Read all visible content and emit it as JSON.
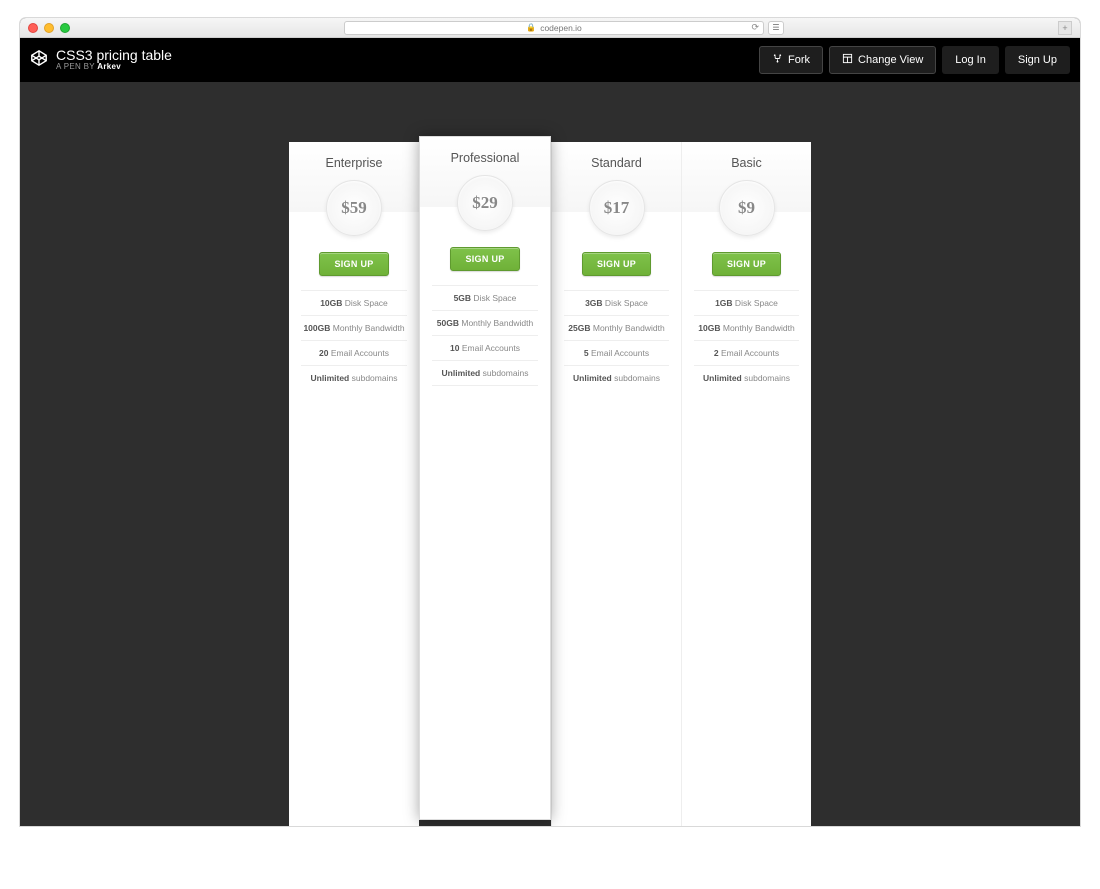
{
  "browser": {
    "url_host": "codepen.io"
  },
  "header": {
    "title": "CSS3 pricing table",
    "subtitle_prefix": "A PEN BY ",
    "author": "Arkev",
    "buttons": {
      "fork": "Fork",
      "change_view": "Change View",
      "login": "Log In",
      "signup": "Sign Up"
    }
  },
  "plans": [
    {
      "name": "Enterprise",
      "price": "$59",
      "cta": "SIGN UP",
      "featured": false,
      "features": [
        {
          "bold": "10GB",
          "text": " Disk Space"
        },
        {
          "bold": "100GB",
          "text": " Monthly Bandwidth"
        },
        {
          "bold": "20",
          "text": " Email Accounts"
        },
        {
          "bold": "Unlimited",
          "text": " subdomains"
        }
      ]
    },
    {
      "name": "Professional",
      "price": "$29",
      "cta": "SIGN UP",
      "featured": true,
      "features": [
        {
          "bold": "5GB",
          "text": " Disk Space"
        },
        {
          "bold": "50GB",
          "text": " Monthly Bandwidth"
        },
        {
          "bold": "10",
          "text": " Email Accounts"
        },
        {
          "bold": "Unlimited",
          "text": " subdomains"
        }
      ]
    },
    {
      "name": "Standard",
      "price": "$17",
      "cta": "SIGN UP",
      "featured": false,
      "features": [
        {
          "bold": "3GB",
          "text": " Disk Space"
        },
        {
          "bold": "25GB",
          "text": " Monthly Bandwidth"
        },
        {
          "bold": "5",
          "text": " Email Accounts"
        },
        {
          "bold": "Unlimited",
          "text": " subdomains"
        }
      ]
    },
    {
      "name": "Basic",
      "price": "$9",
      "cta": "SIGN UP",
      "featured": false,
      "features": [
        {
          "bold": "1GB",
          "text": " Disk Space"
        },
        {
          "bold": "10GB",
          "text": " Monthly Bandwidth"
        },
        {
          "bold": "2",
          "text": " Email Accounts"
        },
        {
          "bold": "Unlimited",
          "text": " subdomains"
        }
      ]
    }
  ]
}
